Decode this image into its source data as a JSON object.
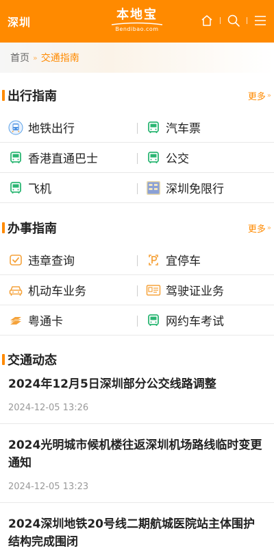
{
  "header": {
    "city": "深圳",
    "logo_text": "本地宝",
    "logo_sub": "Bendibao.com",
    "icons": [
      "home-icon",
      "search-icon",
      "menu-icon"
    ],
    "bg_color": "#ff8a00"
  },
  "breadcrumb": {
    "home": "首页",
    "separator": "»",
    "current": "交通指南"
  },
  "travel": {
    "title": "出行指南",
    "more": "更多",
    "items": [
      {
        "label": "地铁出行",
        "icon": "metro-icon"
      },
      {
        "label": "汽车票",
        "icon": "bus-icon"
      },
      {
        "label": "香港直通巴士",
        "icon": "bus-icon"
      },
      {
        "label": "公交",
        "icon": "bus-icon"
      },
      {
        "label": "飞机",
        "icon": "bus-icon"
      },
      {
        "label": "深圳免限行",
        "icon": "restriction-icon"
      }
    ]
  },
  "affairs": {
    "title": "办事指南",
    "more": "更多",
    "items": [
      {
        "label": "违章查询",
        "icon": "violation-check-icon"
      },
      {
        "label": "宜停车",
        "icon": "parking-icon"
      },
      {
        "label": "机动车业务",
        "icon": "car-icon"
      },
      {
        "label": "驾驶证业务",
        "icon": "license-icon"
      },
      {
        "label": "粤通卡",
        "icon": "card-icon"
      },
      {
        "label": "网约车考试",
        "icon": "bus-icon"
      }
    ]
  },
  "news": {
    "title": "交通动态",
    "items": [
      {
        "title": "2024年12月5日深圳部分公交线路调整",
        "time": "2024-12-05 13:26"
      },
      {
        "title": "2024光明城市候机楼往返深圳机场路线临时变更通知",
        "time": "2024-12-05 13:23"
      },
      {
        "title": "2024深圳地铁20号线二期航城医院站主体围护结构完成围闭",
        "time": ""
      }
    ]
  },
  "colors": {
    "accent": "#ff8a00",
    "icon_green": "#2bb673",
    "icon_orange": "#f5a23a"
  }
}
